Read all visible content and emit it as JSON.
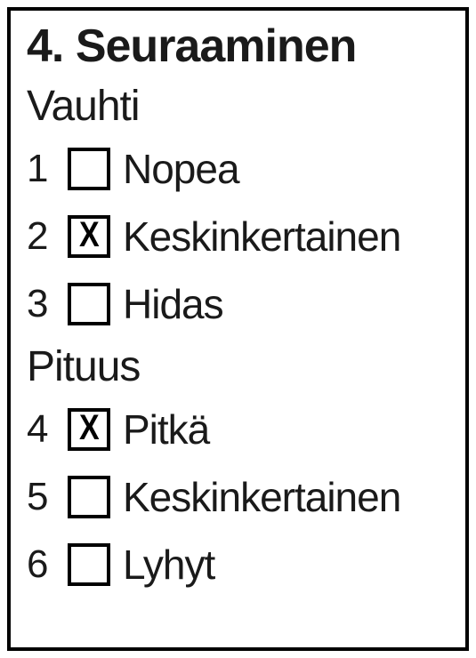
{
  "section": {
    "number": "4.",
    "title": "Seuraaminen"
  },
  "groups": [
    {
      "heading": "Vauhti",
      "options": [
        {
          "number": "1",
          "label": "Nopea",
          "checked": false
        },
        {
          "number": "2",
          "label": "Keskinkertainen",
          "checked": true
        },
        {
          "number": "3",
          "label": "Hidas",
          "checked": false
        }
      ]
    },
    {
      "heading": "Pituus",
      "options": [
        {
          "number": "4",
          "label": "Pitkä",
          "checked": true
        },
        {
          "number": "5",
          "label": "Keskinkertainen",
          "checked": false
        },
        {
          "number": "6",
          "label": "Lyhyt",
          "checked": false
        }
      ]
    }
  ],
  "check_mark": "X"
}
